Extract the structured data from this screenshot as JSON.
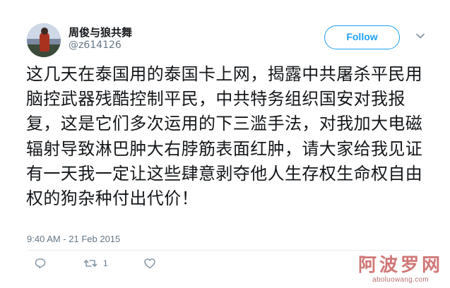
{
  "user": {
    "display_name": "周俊与狼共舞",
    "handle": "@z614126"
  },
  "follow_button": {
    "label": "Follow"
  },
  "tweet": {
    "text": "这几天在泰国用的泰国卡上网，揭露中共屠杀平民用脑控武器残酷控制平民，中共特务组织国安对我报复，这是它们多次运用的下三滥手法，对我加大电磁辐射导致淋巴肿大右脖筋表面红肿，请大家给我见证有一天我一定让这些肆意剥夺他人生存权生命权自由权的狗杂种付出代价！",
    "timestamp": "9:40 AM - 21 Feb 2015"
  },
  "actions": {
    "reply_count": "",
    "retweet_count": "1",
    "like_count": ""
  },
  "watermark": {
    "title": "阿波罗网",
    "url": "aboluowang.com"
  },
  "colors": {
    "accent": "#1da1f2",
    "muted": "#657786",
    "text": "#14171a"
  },
  "icons": {
    "avatar": "profile-photo",
    "more": "chevron-down-icon",
    "reply": "reply-icon",
    "retweet": "retweet-icon",
    "like": "heart-icon"
  }
}
